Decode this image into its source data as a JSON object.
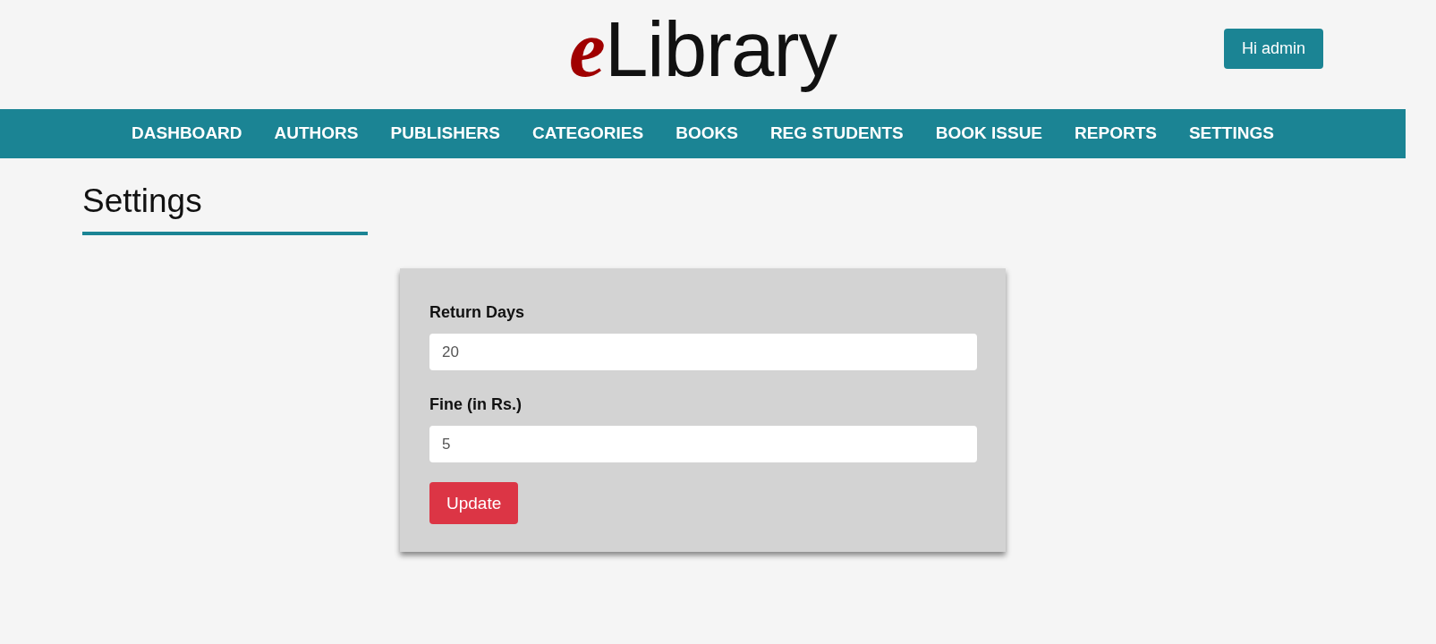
{
  "header": {
    "logo": "eLibrary",
    "user_button": "Hi admin"
  },
  "nav": {
    "items": [
      "DASHBOARD",
      "AUTHORS",
      "PUBLISHERS",
      "CATEGORIES",
      "BOOKS",
      "REG STUDENTS",
      "BOOK ISSUE",
      "REPORTS",
      "SETTINGS"
    ]
  },
  "page_title": "Settings",
  "form": {
    "fields": [
      {
        "label": "Return Days",
        "value": "20"
      },
      {
        "label": "Fine (in Rs.)",
        "value": "5"
      }
    ],
    "submit": "Update"
  }
}
